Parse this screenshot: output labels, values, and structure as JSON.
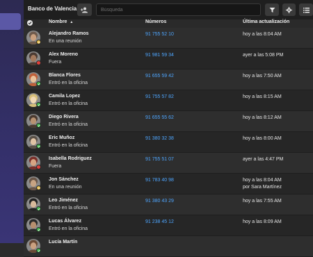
{
  "app": {
    "title": "Banco de Valencia",
    "search_placeholder": "Búsqueda"
  },
  "icons": {
    "add_user": "add-user-icon",
    "filter": "filter-icon",
    "settings": "gear-icon",
    "list": "list-icon",
    "select_all": "check-circle-icon",
    "sort": "sort-ascending-icon"
  },
  "colors": {
    "accent_link": "#4ea6ff",
    "status_available": "#3fb24a",
    "status_busy": "#e0b43a",
    "status_away": "#e2403a"
  },
  "table": {
    "headers": {
      "name": "Nombre",
      "numbers": "Números",
      "updated": "Última actualización"
    },
    "rows": [
      {
        "name": "Alejandro Ramos",
        "status": "En una reunión",
        "status_kind": "busy",
        "number": "91 755 52 10",
        "updated": "hoy a las 8:04 AM",
        "updated_by": ""
      },
      {
        "name": "Alex Moreno",
        "status": "Fuera",
        "status_kind": "away",
        "number": "91 981 59 34",
        "updated": "ayer a las 5:08 PM",
        "updated_by": ""
      },
      {
        "name": "Blanca Flores",
        "status": "Entró en la oficina",
        "status_kind": "available",
        "number": "91 655 59 42",
        "updated": "hoy a las 7:50 AM",
        "updated_by": ""
      },
      {
        "name": "Camila Lopez",
        "status": "Entró en la oficina",
        "status_kind": "available",
        "number": "91 755 57 82",
        "updated": "hoy a las 8:15 AM",
        "updated_by": ""
      },
      {
        "name": "Diego Rivera",
        "status": "Entró en la oficina",
        "status_kind": "available",
        "number": "91 655 55 62",
        "updated": "hoy a las 8:12 AM",
        "updated_by": ""
      },
      {
        "name": "Eric Muñoz",
        "status": "Entró en la oficina",
        "status_kind": "available",
        "number": "91 380 32 38",
        "updated": "hoy a las 8:00 AM",
        "updated_by": ""
      },
      {
        "name": "Isabella Rodriguez",
        "status": "Fuera",
        "status_kind": "away",
        "number": "91 755 51 07",
        "updated": "ayer a las 4:47 PM",
        "updated_by": ""
      },
      {
        "name": "Jon Sánchez",
        "status": "En una reunión",
        "status_kind": "busy",
        "number": "91 783 40 98",
        "updated": "hoy a las 8:04 AM",
        "updated_by": "por Sara Martínez"
      },
      {
        "name": "Leo Jiménez",
        "status": "Entró en la oficina",
        "status_kind": "available",
        "number": "91 380 43 29",
        "updated": "hoy a las 7:55 AM",
        "updated_by": ""
      },
      {
        "name": "Lucas Álvarez",
        "status": "Entró en la oficina",
        "status_kind": "available",
        "number": "91 238 45 12",
        "updated": "hoy a las 8:09 AM",
        "updated_by": ""
      },
      {
        "name": "Lucía Martín",
        "status": "",
        "status_kind": "available",
        "number": "",
        "updated": "",
        "updated_by": ""
      }
    ]
  }
}
